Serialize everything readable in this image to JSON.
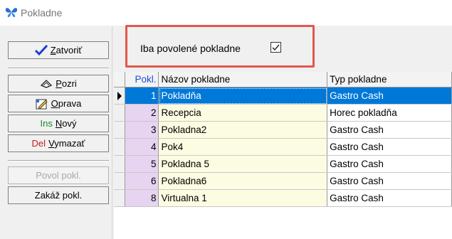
{
  "window": {
    "title": "Pokladne"
  },
  "toolbar": {
    "close": {
      "accel": "Z",
      "rest": "atvoriť"
    },
    "view": {
      "accel": "P",
      "rest": "ozri"
    },
    "edit": {
      "accel": "O",
      "rest": "prava"
    },
    "new": {
      "prefix": "Ins",
      "accel": "N",
      "rest": "ový"
    },
    "delete": {
      "prefix": "Del",
      "accel": "V",
      "rest": "ymazať"
    },
    "enable_label": "Povol pokl.",
    "disable_label": "Zakáž pokl."
  },
  "filter": {
    "label": "Iba povolené pokladne",
    "checked": true,
    "check_glyph": "✓"
  },
  "grid": {
    "columns": [
      "Pokl.",
      "Názov pokladne",
      "Typ pokladne"
    ],
    "rows": [
      {
        "id": "1",
        "name": "Pokladňa",
        "type": "Gastro Cash",
        "selected": true
      },
      {
        "id": "2",
        "name": "Recepcia",
        "type": "Horec pokladňa"
      },
      {
        "id": "3",
        "name": "Pokladna2",
        "type": "Gastro Cash"
      },
      {
        "id": "4",
        "name": "Pok4",
        "type": "Gastro Cash"
      },
      {
        "id": "5",
        "name": "Pokladna 5",
        "type": "Gastro Cash"
      },
      {
        "id": "6",
        "name": "Pokladna6",
        "type": "Gastro Cash"
      },
      {
        "id": "8",
        "name": "Virtualna 1",
        "type": "Gastro Cash"
      }
    ]
  },
  "colors": {
    "selection": "#0078d7",
    "id_cell": "#e7d4f0",
    "data_cell": "#fcfce2",
    "highlight_border": "#e2574c"
  }
}
